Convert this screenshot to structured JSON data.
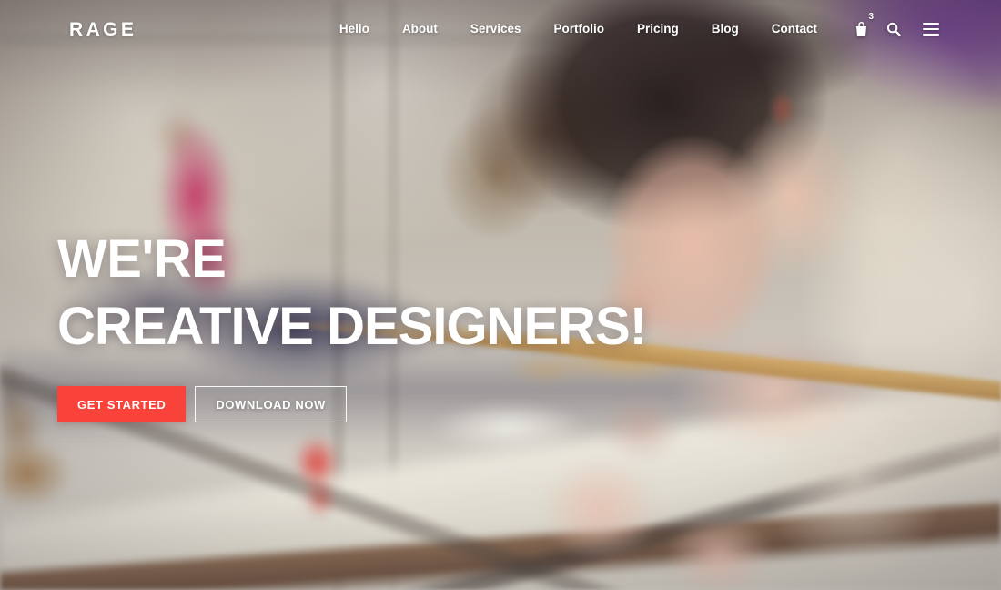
{
  "site": {
    "logo": "RAGE",
    "accent_color": "#f9423a",
    "purple_color": "#7e42a6"
  },
  "navbar": {
    "links": [
      {
        "label": "Hello",
        "name": "nav-link-hello"
      },
      {
        "label": "About",
        "name": "nav-link-about"
      },
      {
        "label": "Services",
        "name": "nav-link-services"
      },
      {
        "label": "Portfolio",
        "name": "nav-link-portfolio"
      },
      {
        "label": "Pricing",
        "name": "nav-link-pricing"
      },
      {
        "label": "Blog",
        "name": "nav-link-blog"
      },
      {
        "label": "Contact",
        "name": "nav-link-contact"
      }
    ],
    "cart": {
      "icon": "shopping-bag-icon",
      "badge_count": "3"
    },
    "search": {
      "icon": "search-icon"
    },
    "menu_toggle": {
      "icon": "hamburger-menu-icon"
    }
  },
  "hero": {
    "headline_line1": "WE'RE",
    "headline_line2": "CREATIVE DESIGNERS!",
    "buttons": [
      {
        "label": "GET STARTED",
        "style": "primary"
      },
      {
        "label": "DOWNLOAD NOW",
        "style": "outline"
      }
    ]
  }
}
